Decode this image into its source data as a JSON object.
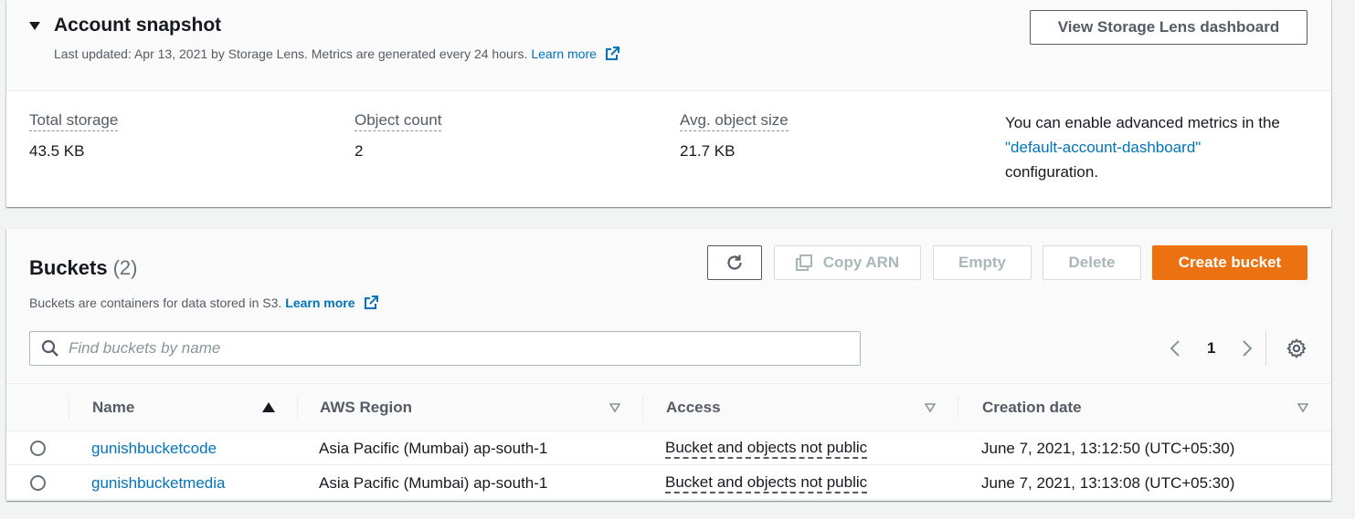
{
  "snapshot": {
    "title": "Account snapshot",
    "subtitle": "Last updated: Apr 13, 2021 by Storage Lens. Metrics are generated every 24 hours.",
    "learn_more": "Learn more",
    "lens_button": "View Storage Lens dashboard",
    "metrics": [
      {
        "label": "Total storage",
        "value": "43.5 KB"
      },
      {
        "label": "Object count",
        "value": "2"
      },
      {
        "label": "Avg. object size",
        "value": "21.7 KB"
      }
    ],
    "advanced_note_prefix": "You can enable advanced metrics in the",
    "advanced_note_link": "\"default-account-dashboard\"",
    "advanced_note_suffix": "configuration."
  },
  "buckets": {
    "title": "Buckets",
    "count": "(2)",
    "description": "Buckets are containers for data stored in S3.",
    "learn_more": "Learn more",
    "buttons": {
      "copy_arn": "Copy ARN",
      "empty": "Empty",
      "delete": "Delete",
      "create": "Create bucket"
    },
    "search_placeholder": "Find buckets by name",
    "page": "1",
    "columns": [
      "Name",
      "AWS Region",
      "Access",
      "Creation date"
    ],
    "rows": [
      {
        "name": "gunishbucketcode",
        "region": "Asia Pacific (Mumbai) ap-south-1",
        "access": "Bucket and objects not public",
        "created": "June 7, 2021, 13:12:50 (UTC+05:30)"
      },
      {
        "name": "gunishbucketmedia",
        "region": "Asia Pacific (Mumbai) ap-south-1",
        "access": "Bucket and objects not public",
        "created": "June 7, 2021, 13:13:08 (UTC+05:30)"
      }
    ]
  },
  "colors": {
    "link": "#0073bb",
    "primary_button": "#ec7211",
    "text": "#16191f",
    "muted": "#545b64"
  }
}
